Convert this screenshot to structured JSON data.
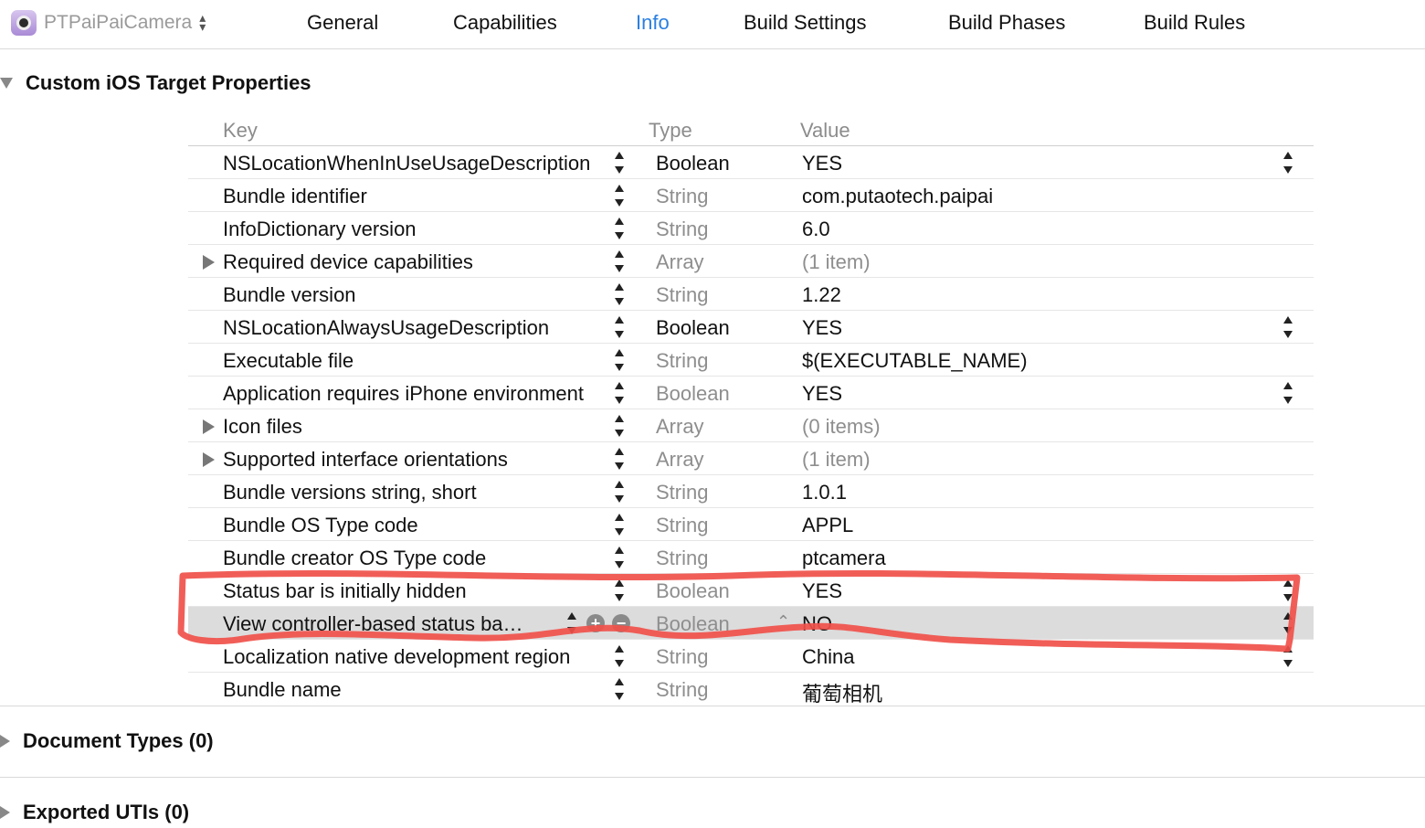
{
  "header": {
    "target_name": "PTPaiPaiCamera",
    "tabs": [
      {
        "label": "General"
      },
      {
        "label": "Capabilities"
      },
      {
        "label": "Info",
        "active": true
      },
      {
        "label": "Build Settings"
      },
      {
        "label": "Build Phases"
      },
      {
        "label": "Build Rules"
      }
    ]
  },
  "sections": {
    "custom": {
      "title": "Custom iOS Target Properties"
    },
    "document_types": {
      "title": "Document Types (0)"
    },
    "exported_utis": {
      "title": "Exported UTIs (0)"
    }
  },
  "table": {
    "columns": {
      "key": "Key",
      "type": "Type",
      "value": "Value"
    },
    "rows": [
      {
        "key": "NSLocationWhenInUseUsageDescription",
        "type": "Boolean",
        "value": "YES"
      },
      {
        "key": "Bundle identifier",
        "type": "String",
        "value": "com.putaotech.paipai"
      },
      {
        "key": "InfoDictionary version",
        "type": "String",
        "value": "6.0"
      },
      {
        "key": "Required device capabilities",
        "type": "Array",
        "value": "(1 item)"
      },
      {
        "key": "Bundle version",
        "type": "String",
        "value": "1.22"
      },
      {
        "key": "NSLocationAlwaysUsageDescription",
        "type": "Boolean",
        "value": "YES"
      },
      {
        "key": "Executable file",
        "type": "String",
        "value": "$(EXECUTABLE_NAME)"
      },
      {
        "key": "Application requires iPhone environment",
        "type": "Boolean",
        "value": "YES"
      },
      {
        "key": "Icon files",
        "type": "Array",
        "value": "(0 items)"
      },
      {
        "key": "Supported interface orientations",
        "type": "Array",
        "value": "(1 item)"
      },
      {
        "key": "Bundle versions string, short",
        "type": "String",
        "value": "1.0.1"
      },
      {
        "key": "Bundle OS Type code",
        "type": "String",
        "value": "APPL"
      },
      {
        "key": "Bundle creator OS Type code",
        "type": "String",
        "value": "ptcamera"
      },
      {
        "key": "Status bar is initially hidden",
        "type": "Boolean",
        "value": "YES"
      },
      {
        "key": "View controller-based status ba…",
        "type": "Boolean",
        "value": "NO"
      },
      {
        "key": "Localization native development region",
        "type": "String",
        "value": "China"
      },
      {
        "key": "Bundle name",
        "type": "String",
        "value": "葡萄相机"
      }
    ]
  },
  "colors": {
    "accent": "#2a7fe0",
    "annotation": "#f0504a",
    "selected_row": "#dcdcdc"
  }
}
